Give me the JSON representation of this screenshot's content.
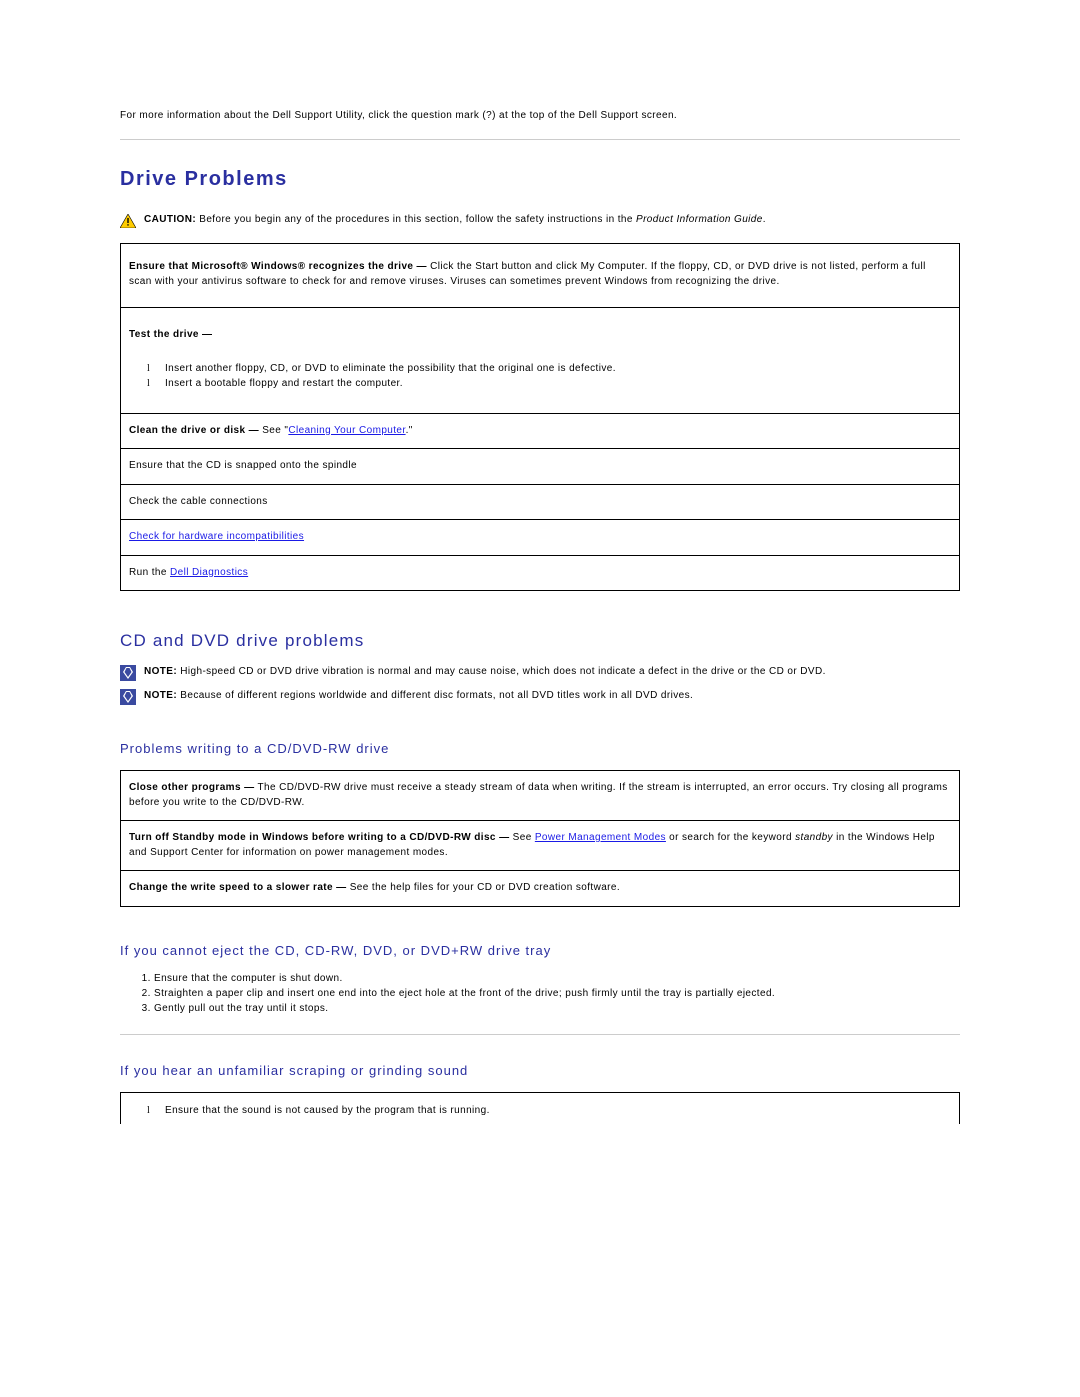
{
  "intro": "For more information about the Dell Support Utility, click the question mark (?) at the top of the Dell Support screen.",
  "heading_drive": "Drive Problems",
  "caution": {
    "label": "CAUTION:",
    "text_before": " Before you begin any of the procedures in this section, follow the safety instructions in the ",
    "italic": "Product Information Guide",
    "after": "."
  },
  "table1": {
    "r1_lead": "Ensure that Microsoft® Windows® recognizes the drive —",
    "r1_rest": "  Click the Start button and click My Computer. If the floppy, CD, or DVD drive is not listed, perform a full scan with your antivirus software to check for and remove viruses. Viruses can sometimes prevent Windows from recognizing the drive.",
    "r2_lead": "Test the drive —",
    "r2_b1": "Insert another floppy, CD, or DVD to eliminate the possibility that the original one is defective.",
    "r2_b2": "Insert a bootable floppy and restart the computer.",
    "r3_lead": "Clean the drive or disk —",
    "r3_see": "  See \"",
    "r3_link": "Cleaning Your Computer",
    "r3_after": ".\"",
    "r4": "Ensure that the CD is snapped onto the spindle",
    "r5": "Check the cable connections",
    "r6": "Check for hardware incompatibilities",
    "r7_before": "Run the ",
    "r7_link": "Dell Diagnostics"
  },
  "heading_cddvd": "CD and DVD drive problems",
  "note1": {
    "label": "NOTE:",
    "text": " High-speed CD or DVD drive vibration is normal and may cause noise, which does not indicate a defect in the drive or the CD or DVD."
  },
  "note2": {
    "label": "NOTE:",
    "text": " Because of different regions worldwide and different disc formats, not all DVD titles work in all DVD drives."
  },
  "heading_write": "Problems writing to a CD/DVD-RW drive",
  "table2": {
    "r1_lead": "Close other programs —",
    "r1_rest": "  The CD/DVD-RW drive must receive a steady stream of data when writing. If the stream is interrupted, an error occurs. Try closing all programs before you write to the CD/DVD-RW.",
    "r2_lead": "Turn off Standby mode in Windows before writing to a CD/DVD-",
    "r2_bold2": "RW disc —",
    "r2_see": "  See ",
    "r2_link": "Power Management Modes",
    "r2_rest1": " or search for the keyword ",
    "r2_italic": "standby",
    "r2_rest2": " in the Windows Help and Support Center for information on power management modes.",
    "r3_lead": "Change the write speed to a slower rate —",
    "r3_rest": " See the help files for your CD or DVD creation software."
  },
  "heading_eject": "If you cannot eject the CD, CD-RW, DVD, or DVD+RW drive tray",
  "eject_steps": [
    "Ensure that the computer is shut down.",
    "Straighten a paper clip and insert one end into the eject hole at the front of the drive; push firmly until the tray is partially ejected.",
    "Gently pull out the tray until it stops."
  ],
  "heading_sound": "If you hear an unfamiliar scraping or grinding sound",
  "sound_bullet": "Ensure that the sound is not caused by the program that is running."
}
